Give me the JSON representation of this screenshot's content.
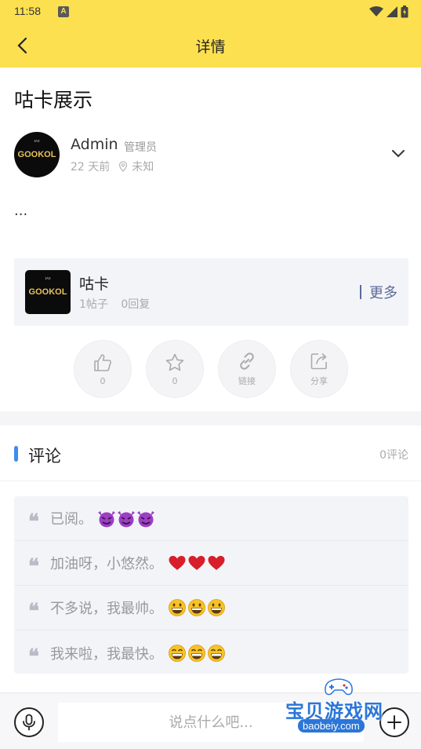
{
  "status_bar": {
    "time": "11:58",
    "notification_letter": "A"
  },
  "header": {
    "title": "详情"
  },
  "post": {
    "title": "咕卡展示",
    "author": {
      "name": "Admin",
      "role": "管理员",
      "avatar_text": "GOOKOL"
    },
    "time_ago": "22 天前",
    "location": "未知",
    "body": "..."
  },
  "forum": {
    "name": "咕卡",
    "logo_text": "GOOKOL",
    "posts": "1帖子",
    "replies": "0回复",
    "more_label": "更多"
  },
  "actions": [
    {
      "icon": "thumb-up-icon",
      "label": "0"
    },
    {
      "icon": "star-icon",
      "label": "0"
    },
    {
      "icon": "link-icon",
      "label": "链接"
    },
    {
      "icon": "share-icon",
      "label": "分享"
    }
  ],
  "comments": {
    "title": "评论",
    "count_label": "0评论"
  },
  "quick_replies": [
    {
      "text": "已阅。",
      "emoji": "devil"
    },
    {
      "text": "加油呀，小悠然。",
      "emoji": "heart"
    },
    {
      "text": "不多说，我最帅。",
      "emoji": "grin"
    },
    {
      "text": "我来啦，我最快。",
      "emoji": "smile"
    }
  ],
  "input": {
    "placeholder": "说点什么吧..."
  },
  "watermark": {
    "brand": "宝贝游戏网",
    "url": "baobeiy.com"
  },
  "colors": {
    "header_bg": "#fce050",
    "accent_blue": "#3b8ef0",
    "card_bg": "#f3f4f8",
    "more_text": "#5b6b9a"
  }
}
